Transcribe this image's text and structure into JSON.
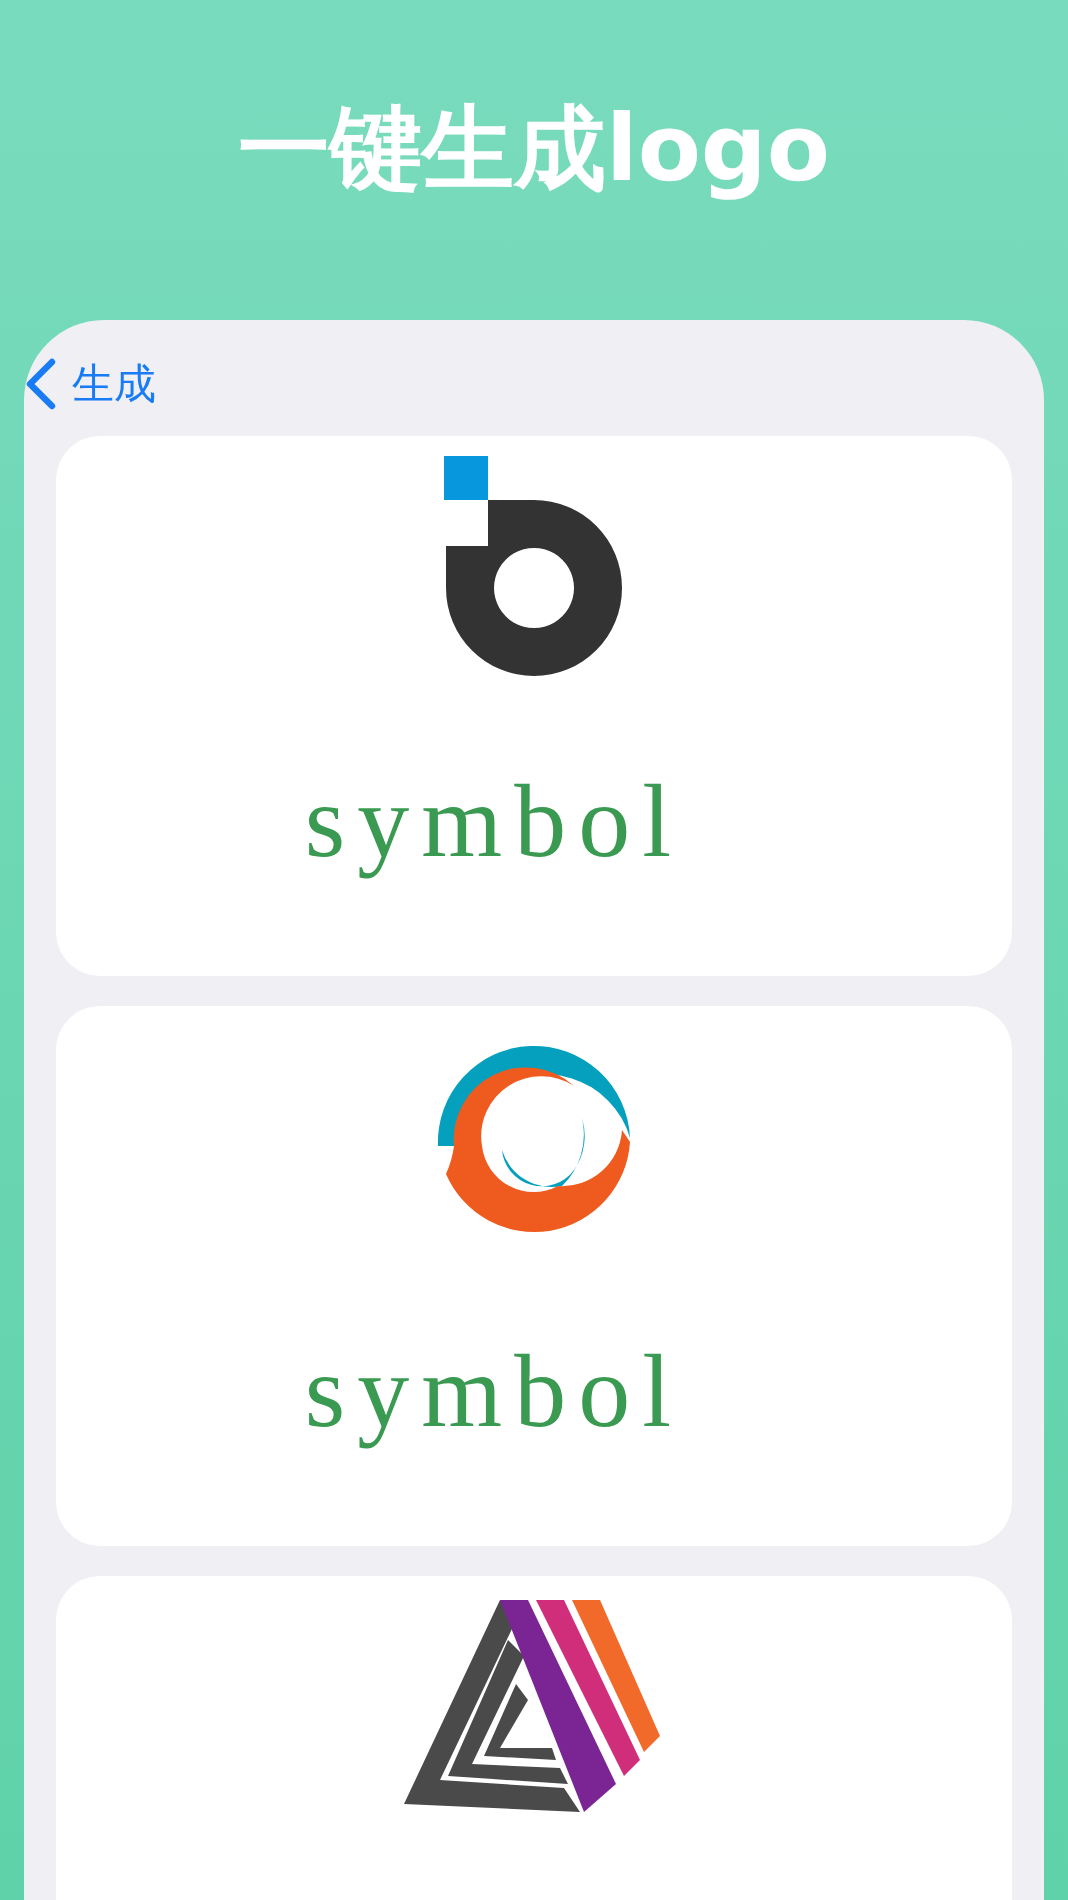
{
  "header": {
    "title": "一键生成logo"
  },
  "nav": {
    "back_label": "生成"
  },
  "cards": [
    {
      "kind": "ring",
      "caption": "symbol"
    },
    {
      "kind": "swirl",
      "caption": "symbol"
    },
    {
      "kind": "triangle"
    }
  ]
}
